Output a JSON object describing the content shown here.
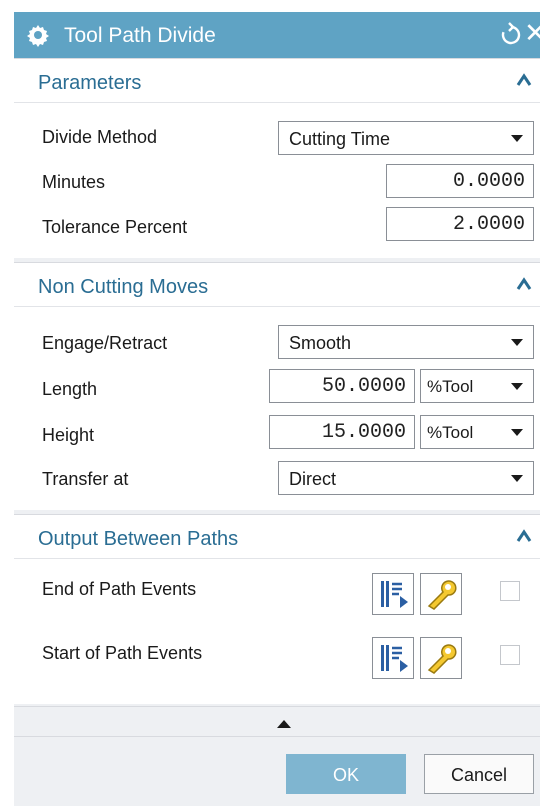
{
  "window": {
    "title": "Tool Path Divide"
  },
  "parameters": {
    "title": "Parameters",
    "divide_method": {
      "label": "Divide Method",
      "value": "Cutting Time"
    },
    "minutes": {
      "label": "Minutes",
      "value": "0.0000"
    },
    "tolerance_percent": {
      "label": "Tolerance Percent",
      "value": "2.0000"
    }
  },
  "non_cutting": {
    "title": "Non Cutting Moves",
    "engage_retract": {
      "label": "Engage/Retract",
      "value": "Smooth"
    },
    "length": {
      "label": "Length",
      "value": "50.0000",
      "unit": "%Tool"
    },
    "height": {
      "label": "Height",
      "value": "15.0000",
      "unit": "%Tool"
    },
    "transfer_at": {
      "label": "Transfer at",
      "value": "Direct"
    }
  },
  "output_between_paths": {
    "title": "Output Between Paths",
    "end_events": {
      "label": "End of Path Events",
      "checked": false
    },
    "start_events": {
      "label": "Start of Path Events",
      "checked": false
    }
  },
  "buttons": {
    "ok": "OK",
    "cancel": "Cancel"
  },
  "colors": {
    "titlebar": "#5fa3c4",
    "section_title": "#2a6d93",
    "ok_button": "#7fb5d0",
    "dialog_bg": "#eef0f3"
  },
  "icons": [
    "gear-icon",
    "reset-icon",
    "close-icon",
    "collapse-caret-icon",
    "event-list-icon",
    "wrench-icon",
    "dropdown-arrow-icon",
    "expand-arrow-icon"
  ]
}
